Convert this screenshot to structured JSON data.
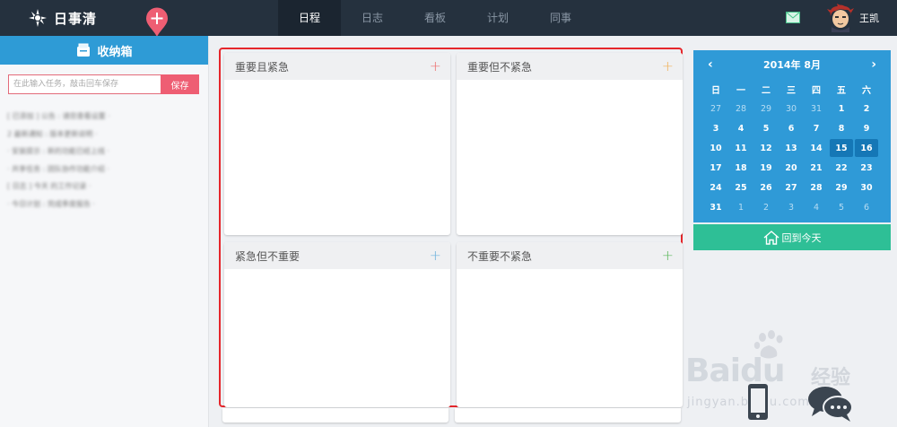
{
  "app": {
    "name": "日事清"
  },
  "nav": {
    "tabs": [
      "日程",
      "日志",
      "看板",
      "计划",
      "同事"
    ],
    "active": 0
  },
  "user": {
    "name": "王凯"
  },
  "inbox": {
    "title": "收纳箱",
    "input_placeholder": "在此输入任务，敲击回车保存",
    "save_label": "保存",
    "items": [
      "[ 已添加 ] 公告 : 请您查看设置 ·",
      "2 最新通知 : 版本更新说明 ·",
      "· 安装提示 : 新的功能已经上线 ·",
      "· 共享任务 : 团队协作功能介绍 ·",
      "[ 日志 ] 今天 的工作记录 ·",
      "· 今日计划 : 完成季度报告 ·"
    ]
  },
  "quadrants": [
    {
      "title": "重要且紧急",
      "add": "+",
      "color": "#ee6f6f"
    },
    {
      "title": "重要但不紧急",
      "add": "+",
      "color": "#f0b25a"
    },
    {
      "title": "紧急但不重要",
      "add": "+",
      "color": "#6fb3dd"
    },
    {
      "title": "不重要不紧急",
      "add": "+",
      "color": "#5cb85c"
    }
  ],
  "calendar": {
    "title": "2014年 8月",
    "prev": "‹",
    "next": "›",
    "weekdays": [
      "日",
      "一",
      "二",
      "三",
      "四",
      "五",
      "六"
    ],
    "days": [
      [
        "27",
        "28",
        "29",
        "30",
        "31",
        "1",
        "2"
      ],
      [
        "3",
        "4",
        "5",
        "6",
        "7",
        "8",
        "9"
      ],
      [
        "10",
        "11",
        "12",
        "13",
        "14",
        "15",
        "16"
      ],
      [
        "17",
        "18",
        "19",
        "20",
        "21",
        "22",
        "23"
      ],
      [
        "24",
        "25",
        "26",
        "27",
        "28",
        "29",
        "30"
      ],
      [
        "31",
        "1",
        "2",
        "3",
        "4",
        "5",
        "6"
      ]
    ],
    "muted": [
      [
        0,
        0
      ],
      [
        0,
        1
      ],
      [
        0,
        2
      ],
      [
        0,
        3
      ],
      [
        0,
        4
      ],
      [
        5,
        1
      ],
      [
        5,
        2
      ],
      [
        5,
        3
      ],
      [
        5,
        4
      ],
      [
        5,
        5
      ],
      [
        5,
        6
      ]
    ],
    "selected": [
      [
        2,
        5
      ],
      [
        2,
        6
      ]
    ],
    "today_label": "回到今天"
  },
  "watermark": {
    "brand": "Bai",
    "brand2": "du",
    "cn": "经验",
    "url": "jingyan.baidu.com"
  },
  "colors": {
    "topbar": "#25313e",
    "accent": "#2f9ad7",
    "save": "#ee5e73",
    "today": "#2ebf96",
    "board_border": "#e5262b"
  }
}
